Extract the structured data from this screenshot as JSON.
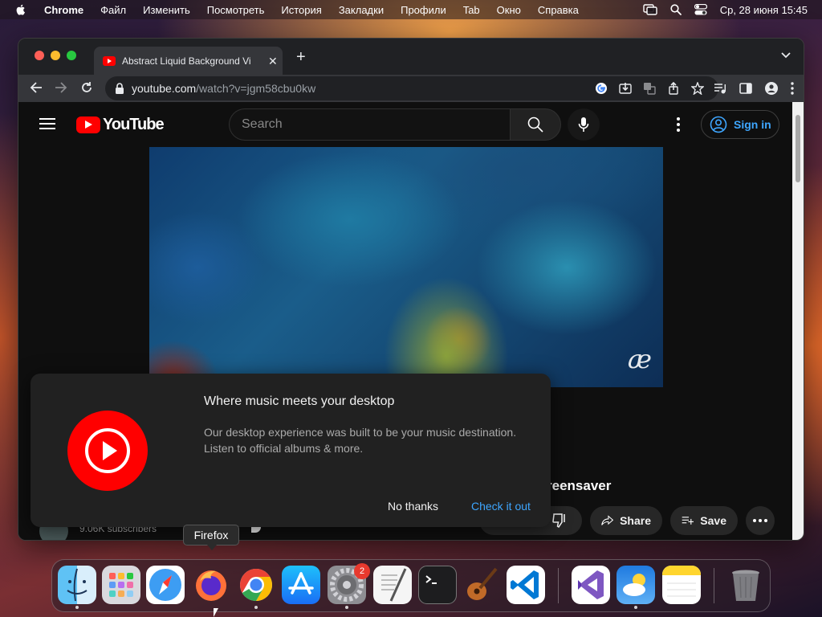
{
  "menubar": {
    "app_name": "Chrome",
    "items": [
      "Файл",
      "Изменить",
      "Посмотреть",
      "История",
      "Закладки",
      "Профили",
      "Tab",
      "Окно",
      "Справка"
    ],
    "clock": "Ср, 28 июня  15:45"
  },
  "browser": {
    "tab_title": "Abstract Liquid Background Vi",
    "url_host": "youtube.com",
    "url_path": "/watch?v=jgm58cbu0kw"
  },
  "youtube": {
    "logo_text": "YouTube",
    "search_placeholder": "Search",
    "signin_label": "Sign in",
    "video_title_fragment": "reensaver",
    "subscribers": "9.06K subscribers",
    "share_label": "Share",
    "save_label": "Save",
    "watermark": "æ"
  },
  "promo": {
    "title": "Where music meets your desktop",
    "body": "Our desktop experience was built to be your music destination. Listen to official albums & more.",
    "dismiss_label": "No thanks",
    "accept_label": "Check it out"
  },
  "dock": {
    "tooltip": "Firefox",
    "settings_badge": "2",
    "apps": [
      "finder",
      "launchpad",
      "safari",
      "firefox",
      "chrome",
      "app-store",
      "system-settings",
      "textedit",
      "terminal",
      "garageband",
      "vscode",
      "visual-studio",
      "weather",
      "notes",
      "trash"
    ]
  },
  "colors": {
    "youtube_red": "#ff0000",
    "link_blue": "#3ea6ff",
    "page_bg": "#0f0f0f"
  }
}
